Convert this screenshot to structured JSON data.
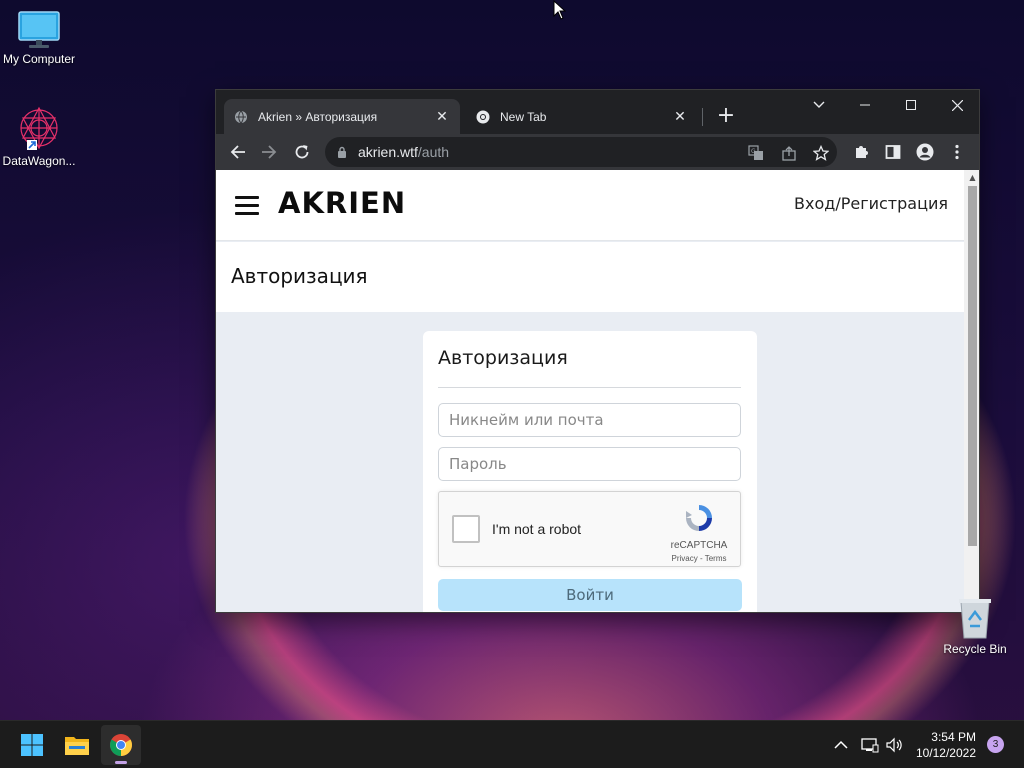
{
  "desktop": {
    "icons": [
      {
        "label": "My Computer",
        "icon": "monitor-icon"
      },
      {
        "label": "DataWagon...",
        "icon": "datawagon-icon"
      },
      {
        "label": "Recycle Bin",
        "icon": "recycle-bin-icon"
      }
    ]
  },
  "browser": {
    "tabs": [
      {
        "title": "Akrien » Авторизация",
        "icon": "globe-icon",
        "active": true
      },
      {
        "title": "New Tab",
        "icon": "chrome-icon",
        "active": false
      }
    ],
    "url_host": "akrien.wtf",
    "url_path": "/auth",
    "colors": {
      "frame": "#202124",
      "toolbar": "#35363a"
    }
  },
  "site": {
    "logo": "AKRIEN",
    "login_link": "Вход/Регистрация",
    "page_title": "Авторизация",
    "form": {
      "title": "Авторизация",
      "username_placeholder": "Никнейм или почта",
      "password_placeholder": "Пароль",
      "captcha_label": "I'm not a robot",
      "captcha_brand": "reCAPTCHA",
      "captcha_links": "Privacy - Terms",
      "submit_label": "Войти"
    },
    "colors": {
      "page_bg": "#e9edf3",
      "button_bg": "#b7e3fb"
    }
  },
  "taskbar": {
    "apps": [
      {
        "name": "start",
        "icon": "windows-logo-icon"
      },
      {
        "name": "file-explorer",
        "icon": "folder-icon"
      },
      {
        "name": "chrome",
        "icon": "chrome-icon",
        "active": true
      }
    ],
    "time": "3:54 PM",
    "date": "10/12/2022",
    "notifications": "3"
  }
}
